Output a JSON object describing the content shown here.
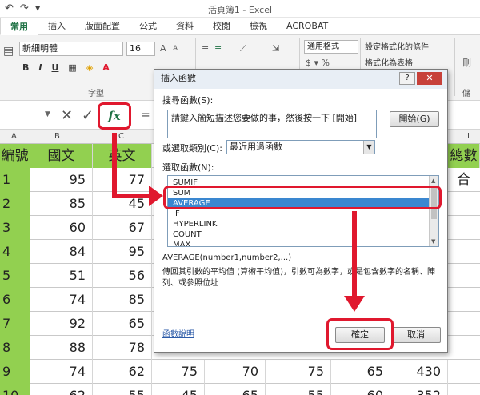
{
  "window": {
    "title": "活頁簿1 - Excel"
  },
  "qat": {
    "undo": "↶",
    "redo": "↷",
    "more": "▾"
  },
  "ribbon": {
    "tabs": [
      {
        "label": "常用",
        "active": true
      },
      {
        "label": "插入"
      },
      {
        "label": "版面配置"
      },
      {
        "label": "公式"
      },
      {
        "label": "資料"
      },
      {
        "label": "校閱"
      },
      {
        "label": "檢視"
      },
      {
        "label": "ACROBAT"
      }
    ],
    "font_name": "新細明體",
    "font_size": "16",
    "bold": "B",
    "italic": "I",
    "underline": "U",
    "font_group_label": "字型",
    "number_format": "通用格式",
    "percent": "$ ▾ %",
    "conditional_format": "設定格式化的條件",
    "format_as_table": "格式化為表格",
    "cells_label": "儲",
    "delete_label": "刪"
  },
  "formula_bar": {
    "cancel": "✕",
    "enter": "✓",
    "fx": "fx",
    "equals": "="
  },
  "grid": {
    "col_headers": [
      "A",
      "B",
      "C",
      "I"
    ],
    "header_row": [
      "編號",
      "國文",
      "英文",
      "總數合"
    ],
    "rows": [
      {
        "id": "1",
        "b": "95",
        "c": "77"
      },
      {
        "id": "2",
        "b": "85",
        "c": "45"
      },
      {
        "id": "3",
        "b": "60",
        "c": "67"
      },
      {
        "id": "4",
        "b": "84",
        "c": "95"
      },
      {
        "id": "5",
        "b": "51",
        "c": "56"
      },
      {
        "id": "6",
        "b": "74",
        "c": "85"
      },
      {
        "id": "7",
        "b": "92",
        "c": "65"
      },
      {
        "id": "8",
        "b": "88",
        "c": "78"
      },
      {
        "id": "9",
        "b": "74",
        "c": "62",
        "d": "75",
        "e": "70",
        "f": "75",
        "g": "65",
        "h": "430"
      },
      {
        "id": "10",
        "b": "62",
        "c": "55",
        "d": "45",
        "e": "65",
        "f": "55",
        "g": "60",
        "h": "352"
      }
    ]
  },
  "dialog": {
    "title": "插入函數",
    "help": "?",
    "close": "✕",
    "search_label": "搜尋函數(S):",
    "search_text": "請鍵入簡短描述您要做的事，然後按一下 [開始]",
    "go_button": "開始(G)",
    "category_label": "或選取類別(C):",
    "category_value": "最近用過函數",
    "select_label": "選取函數(N):",
    "functions": [
      "SUMIF",
      "SUM",
      "AVERAGE",
      "IF",
      "HYPERLINK",
      "COUNT",
      "MAX"
    ],
    "selected_index": 2,
    "syntax": "AVERAGE(number1,number2,...)",
    "description": "傳回其引數的平均值 (算術平均值)，引數可為數字，或是包含數字的名稱、陣列、或參照位址",
    "help_link": "函數說明",
    "ok_button": "確定",
    "cancel_button": "取消"
  },
  "accent": "#217346",
  "highlight_color": "#e0182e",
  "selected_row_color": "#3a87d0",
  "header_fill": "#92d050"
}
